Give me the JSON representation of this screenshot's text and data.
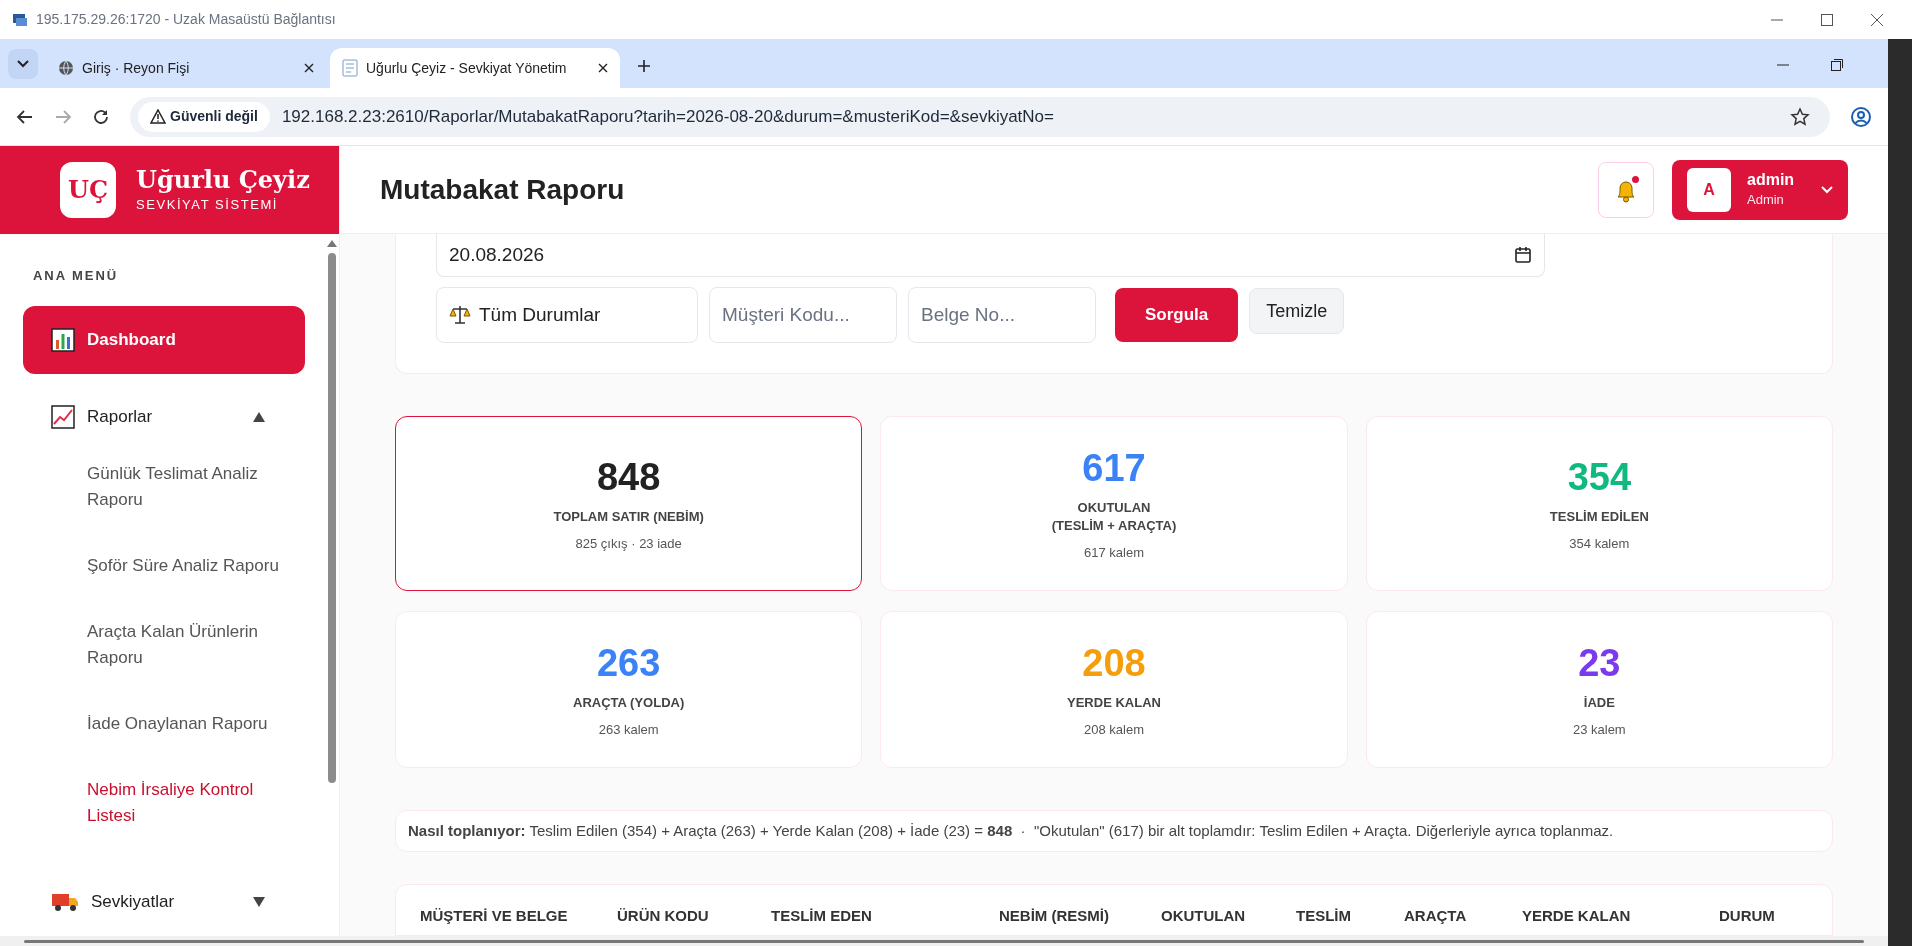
{
  "remote_window": {
    "title": "195.175.29.26:1720 - Uzak Masaüstü Bağlantısı"
  },
  "browser": {
    "tabs": [
      {
        "title": "Giriş · Reyon Fişi",
        "selected": false
      },
      {
        "title": "Uğurlu Çeyiz - Sevkiyat Yönetim",
        "selected": true
      }
    ],
    "security_label": "Güvenli değil",
    "url": "192.168.2.23:2610/Raporlar/MutabakatRaporu?tarih=2026-08-20&durum=&musteriKod=&sevkiyatNo="
  },
  "brand": {
    "logo": "UÇ",
    "name": "Uğurlu Çeyiz",
    "subtitle": "SEVKİYAT SİSTEMİ"
  },
  "sidebar": {
    "section": "ANA MENÜ",
    "items": [
      {
        "label": "Dashboard",
        "selected": true
      },
      {
        "label": "Raporlar",
        "selected": false,
        "expanded": true,
        "children": [
          {
            "label": "Günlük Teslimat Analiz Raporu",
            "selected": false
          },
          {
            "label": "Şoför Süre Analiz Raporu",
            "selected": false
          },
          {
            "label": "Araçta Kalan Ürünlerin Raporu",
            "selected": false
          },
          {
            "label": "İade Onaylanan Raporu",
            "selected": false
          },
          {
            "label": "Nebim İrsaliye Kontrol Listesi",
            "selected": true
          }
        ]
      },
      {
        "label": "Sevkiyatlar",
        "selected": false,
        "expanded": false
      }
    ]
  },
  "header": {
    "title": "Mutabakat Raporu",
    "has_unread": true,
    "user": {
      "initial": "A",
      "name": "admin",
      "role": "Admin"
    }
  },
  "filters": {
    "date": "20.08.2026",
    "status": "Tüm Durumlar",
    "customer_placeholder": "Müşteri Kodu...",
    "document_placeholder": "Belge No...",
    "buttons": [
      {
        "label": "Sorgula",
        "kind": "primary"
      },
      {
        "label": "Temizle",
        "kind": "secondary"
      }
    ]
  },
  "stats": [
    {
      "value": "848",
      "label": "TOPLAM SATIR (NEBİM)",
      "detail": "825 çıkış · 23 iade",
      "color": "#222222",
      "selected": true
    },
    {
      "value": "617",
      "label": "OKUTULAN\n(TESLİM + ARAÇTA)",
      "detail": "617 kalem",
      "color": "#3b82f6",
      "selected": false
    },
    {
      "value": "354",
      "label": "TESLİM EDİLEN",
      "detail": "354 kalem",
      "color": "#10b981",
      "selected": false
    },
    {
      "value": "263",
      "label": "ARAÇTA (YOLDA)",
      "detail": "263 kalem",
      "color": "#3b82f6",
      "selected": false
    },
    {
      "value": "208",
      "label": "YERDE KALAN",
      "detail": "208 kalem",
      "color": "#f59e0b",
      "selected": false
    },
    {
      "value": "23",
      "label": "İADE",
      "detail": "23 kalem",
      "color": "#7c3aed",
      "selected": false
    }
  ],
  "formula": "**Nasıl toplanıyor:** Teslim Edilen (354) + Araçta (263) + Yerde Kalan (208) + İade (23) = **848**  ·  \"Okutulan\" (617) bir alt toplamdır: Teslim Edilen + Araçta. Diğerleriyle ayrıca toplanmaz.",
  "table": {
    "columns": [
      "MÜŞTERİ VE BELGE",
      "ÜRÜN KODU",
      "TESLİM EDEN",
      "NEBİM (RESMİ)",
      "OKUTULAN",
      "TESLİM",
      "ARAÇTA",
      "YERDE KALAN",
      "DURUM"
    ]
  }
}
